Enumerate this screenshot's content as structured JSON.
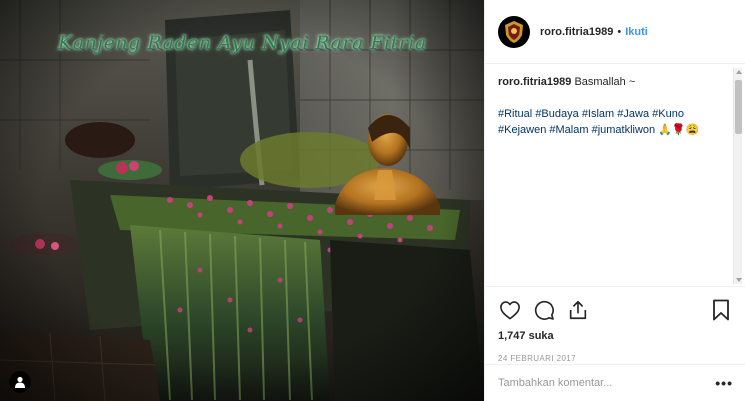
{
  "post": {
    "image_overlay_text": "Kanjeng Raden Ayu Nyai Rara Fitria",
    "user_tag_icon": "user-tag-icon"
  },
  "header": {
    "username": "roro.fitria1989",
    "separator": "•",
    "follow_label": "Ikuti",
    "avatar_icon": "crest-avatar-icon"
  },
  "caption": {
    "author": "roro.fitria1989",
    "text": "Basmallah ~",
    "hashtags_line1": [
      "#Ritual",
      "#Budaya",
      "#Islam",
      "#Jawa",
      "#Kuno"
    ],
    "hashtags_line2": [
      "#Kejawen",
      "#Malam",
      "#jumatkliwon"
    ],
    "emojis": "🙏🌹😩"
  },
  "actions": {
    "icons": [
      "heart-icon",
      "comment-icon",
      "share-icon",
      "bookmark-icon"
    ],
    "likes": "1,747 suka",
    "date": "24 FEBRUARI 2017"
  },
  "comment_box": {
    "placeholder": "Tambahkan komentar...",
    "more_label": "•••"
  },
  "colors": {
    "accent": "#3897f0",
    "hashtag": "#003569",
    "text": "#262626",
    "muted": "#999999",
    "border": "#efefef"
  }
}
